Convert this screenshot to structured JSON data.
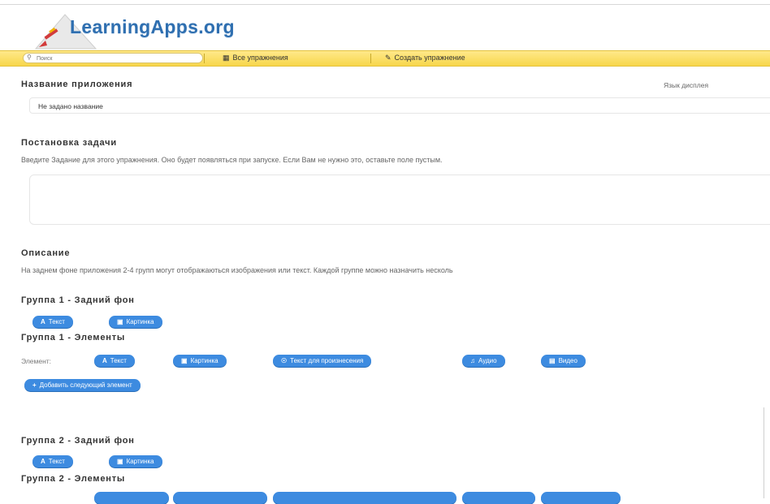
{
  "header": {
    "logo_text": "LearningApps.org"
  },
  "navbar": {
    "search_placeholder": "Поиск",
    "all_exercises": "Все упражнения",
    "create_exercise": "Создать упражнение"
  },
  "app_name": {
    "heading": "Название приложения",
    "value": "Не задано название",
    "display_language_label": "Язык дисплея"
  },
  "task": {
    "heading": "Постановка задачи",
    "hint": "Введите Задание для этого упражнения. Оно будет появляться при запуске. Если Вам не нужно это, оставьте поле пустым."
  },
  "description": {
    "heading": "Описание",
    "text": "На заднем фоне приложения 2-4 групп могут отображаються изображения или текст. Каждой группе можно назначить несколь"
  },
  "group1": {
    "bg_heading": "Группа 1 - Задний фон",
    "bg_text_button": "Текст",
    "bg_image_button": "Картинка",
    "elements_heading": "Группа 1 - Элементы",
    "element_label": "Элемент:",
    "el_text": "Текст",
    "el_image": "Картинка",
    "el_speech": "Текст для произнесения",
    "el_audio": "Аудио",
    "el_video": "Видео",
    "add_next": "Добавить следующий элемент"
  },
  "group2": {
    "bg_heading": "Группа 2 - Задний фон",
    "bg_text_button": "Текст",
    "bg_image_button": "Картинка",
    "elements_heading": "Группа 2 - Элементы"
  },
  "colors": {
    "accent_blue": "#3d8be0",
    "navbar_yellow": "#f7d64a",
    "logo_blue": "#2f6fb0"
  }
}
